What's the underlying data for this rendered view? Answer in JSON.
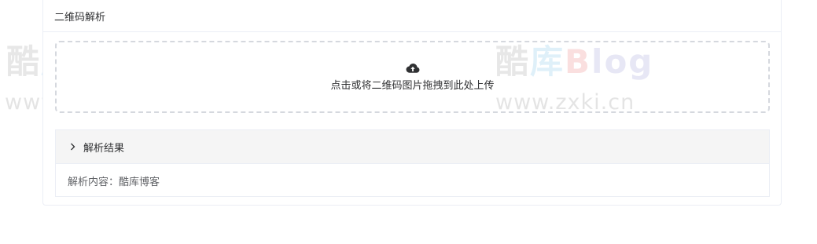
{
  "card": {
    "title": "二维码解析"
  },
  "upload": {
    "icon": "cloud-upload-icon",
    "text": "点击或将二维码图片拖拽到此处上传"
  },
  "result": {
    "icon": "chevron-right-icon",
    "title": "解析结果",
    "content": "解析内容：酷库博客"
  },
  "watermark": {
    "brand_cn": "酷",
    "brand_cn2": "库",
    "brand_b": "B",
    "brand_log": "log",
    "url": "www.zxki.cn"
  }
}
